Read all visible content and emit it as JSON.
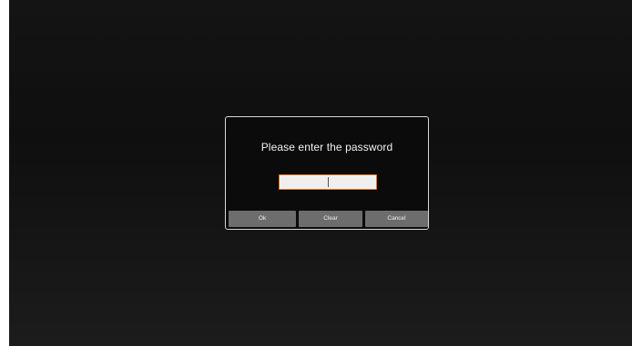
{
  "dialog": {
    "title": "Please enter the password",
    "password": {
      "value": "",
      "placeholder": ""
    },
    "buttons": {
      "ok": "Ok",
      "clear": "Clear",
      "cancel": "Cancel"
    }
  },
  "colors": {
    "background": "#141414",
    "dialog_border": "#d8d8d8",
    "input_border": "#e07a1f",
    "button_bg": "#6d6d6d"
  }
}
